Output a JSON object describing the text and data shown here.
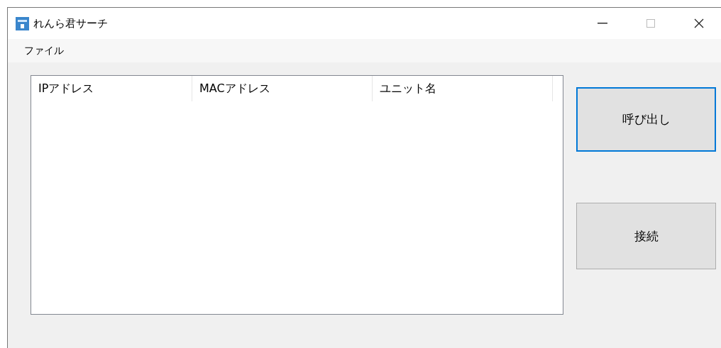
{
  "window": {
    "title": "れんら君サーチ"
  },
  "menu": [
    {
      "label": "ファイル"
    }
  ],
  "table": {
    "columns": [
      "IPアドレス",
      "MACアドレス",
      "ユニット名"
    ]
  },
  "buttons": [
    {
      "label": "呼び出し",
      "focused": true
    },
    {
      "label": "接続",
      "focused": false
    }
  ]
}
